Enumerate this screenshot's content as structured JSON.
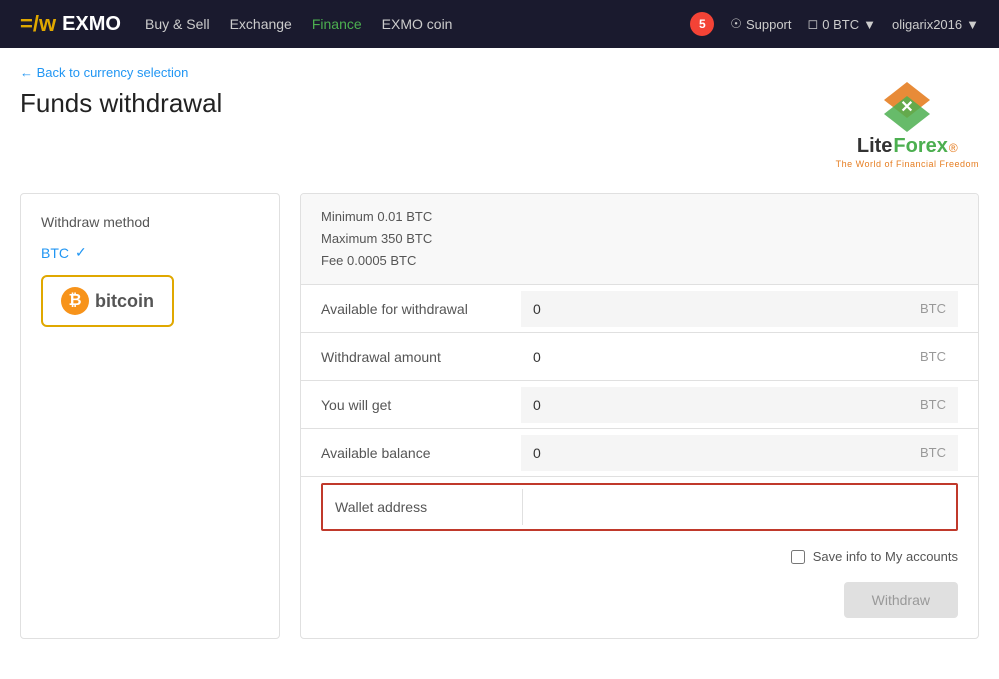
{
  "navbar": {
    "logo_symbol": "=/w",
    "logo_text": "EXMO",
    "links": [
      {
        "label": "Buy & Sell",
        "active": false
      },
      {
        "label": "Exchange",
        "active": false
      },
      {
        "label": "Finance",
        "active": true
      },
      {
        "label": "EXMO coin",
        "active": false
      }
    ],
    "notification_count": "5",
    "support_label": "Support",
    "balance_label": "0 BTC",
    "username": "oligarix2016"
  },
  "breadcrumb": {
    "back_label": "← Back to currency selection"
  },
  "page": {
    "title": "Funds withdrawal"
  },
  "liteforex": {
    "brand_name": "LiteForex",
    "reg_mark": "®",
    "tagline": "The World of Financial Freedom"
  },
  "left_panel": {
    "method_label": "Withdraw method",
    "selected_method": "BTC",
    "bitcoin_button_label": "bitcoin"
  },
  "right_panel": {
    "limits": {
      "minimum": "Minimum 0.01 BTC",
      "maximum": "Maximum 350 BTC",
      "fee": "Fee 0.0005 BTC"
    },
    "rows": [
      {
        "label": "Available for withdrawal",
        "value": "0",
        "currency": "BTC"
      },
      {
        "label": "Withdrawal amount",
        "value": "0",
        "currency": "BTC"
      },
      {
        "label": "You will get",
        "value": "0",
        "currency": "BTC"
      },
      {
        "label": "Available balance",
        "value": "0",
        "currency": "BTC"
      }
    ],
    "wallet_label": "Wallet address",
    "wallet_placeholder": "",
    "save_label": "Save info to My accounts",
    "withdraw_button": "Withdraw"
  }
}
